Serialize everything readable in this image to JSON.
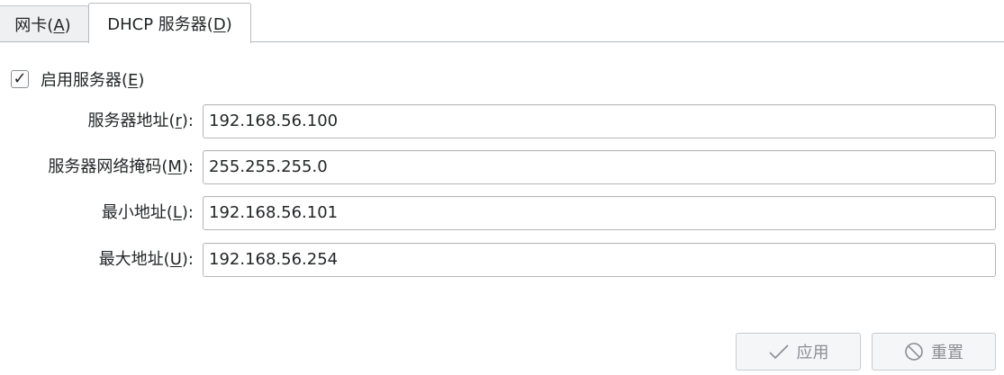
{
  "tabs": [
    {
      "label": "网卡(",
      "mnemonic": "A",
      "suffix": ")",
      "active": false
    },
    {
      "label": "DHCP 服务器(",
      "mnemonic": "D",
      "suffix": ")",
      "active": true
    }
  ],
  "enable_server": {
    "label": "启用服务器(",
    "mnemonic": "E",
    "suffix": ")",
    "checked": true,
    "check_glyph": "✓"
  },
  "fields": [
    {
      "label": "服务器地址(",
      "mnemonic": "r",
      "suffix": "):",
      "value": "192.168.56.100"
    },
    {
      "label": "服务器网络掩码(",
      "mnemonic": "M",
      "suffix": "):",
      "value": "255.255.255.0"
    },
    {
      "label": "最小地址(",
      "mnemonic": "L",
      "suffix": "):",
      "value": "192.168.56.101"
    },
    {
      "label": "最大地址(",
      "mnemonic": "U",
      "suffix": "):",
      "value": "192.168.56.254"
    }
  ],
  "buttons": {
    "apply": {
      "label": "应用",
      "icon": "checkmark-icon",
      "enabled": false
    },
    "reset": {
      "label": "重置",
      "icon": "cancel-icon",
      "enabled": false
    }
  },
  "colors": {
    "disabled_text": "#8a8e92",
    "border": "#b3b6b9"
  }
}
